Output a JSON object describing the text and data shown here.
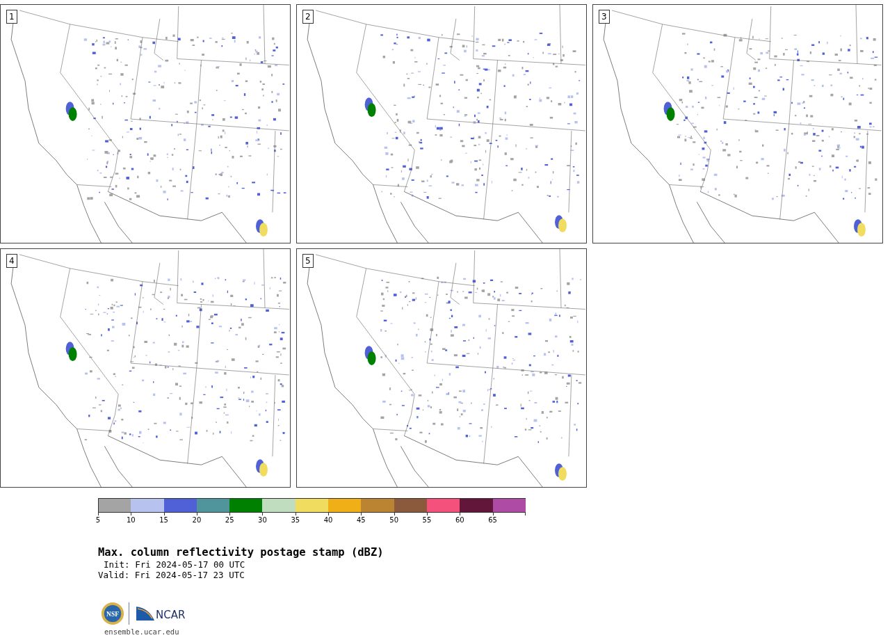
{
  "panels": [
    {
      "label": "1"
    },
    {
      "label": "2"
    },
    {
      "label": "3"
    },
    {
      "label": "4"
    },
    {
      "label": "5"
    }
  ],
  "colorbar": {
    "segments": [
      {
        "label": "5",
        "color": "#a4a4a4"
      },
      {
        "label": "10",
        "color": "#b7c2ee"
      },
      {
        "label": "15",
        "color": "#5060d6"
      },
      {
        "label": "20",
        "color": "#4f959b"
      },
      {
        "label": "25",
        "color": "#008000"
      },
      {
        "label": "30",
        "color": "#c0ddbf"
      },
      {
        "label": "35",
        "color": "#f0dc5f"
      },
      {
        "label": "40",
        "color": "#f0ae17"
      },
      {
        "label": "45",
        "color": "#bb8433"
      },
      {
        "label": "50",
        "color": "#8b5a3d"
      },
      {
        "label": "55",
        "color": "#f5517d"
      },
      {
        "label": "60",
        "color": "#62173a"
      },
      {
        "label": "65",
        "color": "#ae4ba5"
      }
    ]
  },
  "title": "Max. column reflectivity postage stamp (dBZ)",
  "init": "Init: Fri 2024-05-17 00 UTC",
  "valid": "Valid: Fri 2024-05-17 23 UTC",
  "logos": {
    "nsf": "NSF",
    "ncar": "NCAR"
  },
  "site": "ensemble.ucar.edu"
}
